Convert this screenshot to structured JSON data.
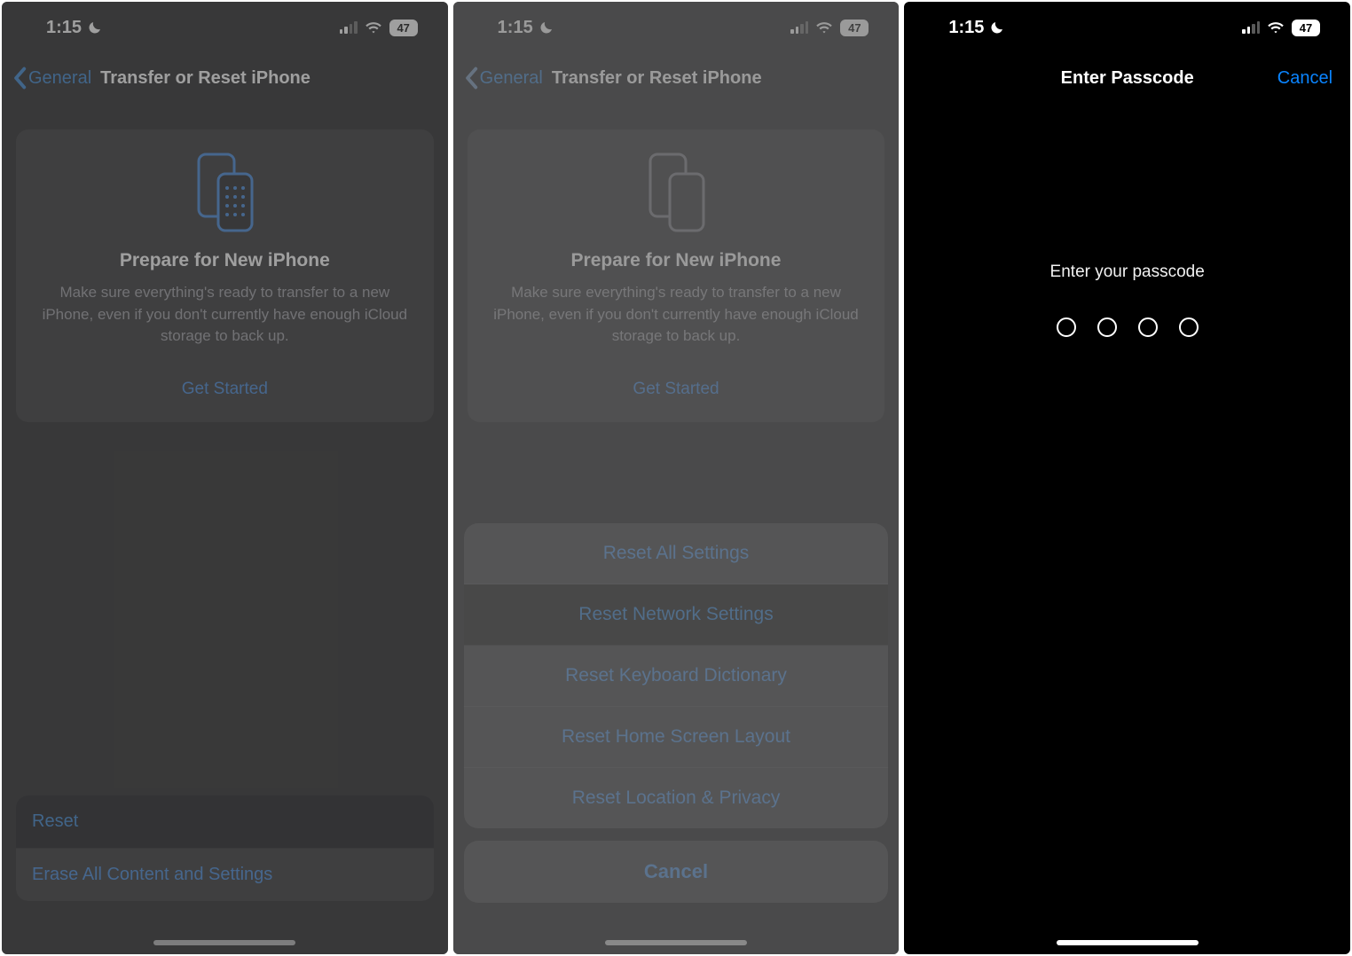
{
  "status": {
    "time": "1:15",
    "battery": "47"
  },
  "panel1": {
    "back_label": "General",
    "title": "Transfer or Reset iPhone",
    "prepare_title": "Prepare for New iPhone",
    "prepare_desc": "Make sure everything's ready to transfer to a new iPhone, even if you don't currently have enough iCloud storage to back up.",
    "prepare_action": "Get Started",
    "row_reset": "Reset",
    "row_erase": "Erase All Content and Settings"
  },
  "panel2": {
    "back_label": "General",
    "title": "Transfer or Reset iPhone",
    "prepare_title": "Prepare for New iPhone",
    "prepare_desc": "Make sure everything's ready to transfer to a new iPhone, even if you don't currently have enough iCloud storage to back up.",
    "prepare_action": "Get Started",
    "sheet": {
      "opt1": "Reset All Settings",
      "opt2": "Reset Network Settings",
      "opt3": "Reset Keyboard Dictionary",
      "opt4": "Reset Home Screen Layout",
      "opt5": "Reset Location & Privacy",
      "cancel": "Cancel"
    }
  },
  "panel3": {
    "title": "Enter Passcode",
    "cancel": "Cancel",
    "prompt": "Enter your passcode"
  }
}
